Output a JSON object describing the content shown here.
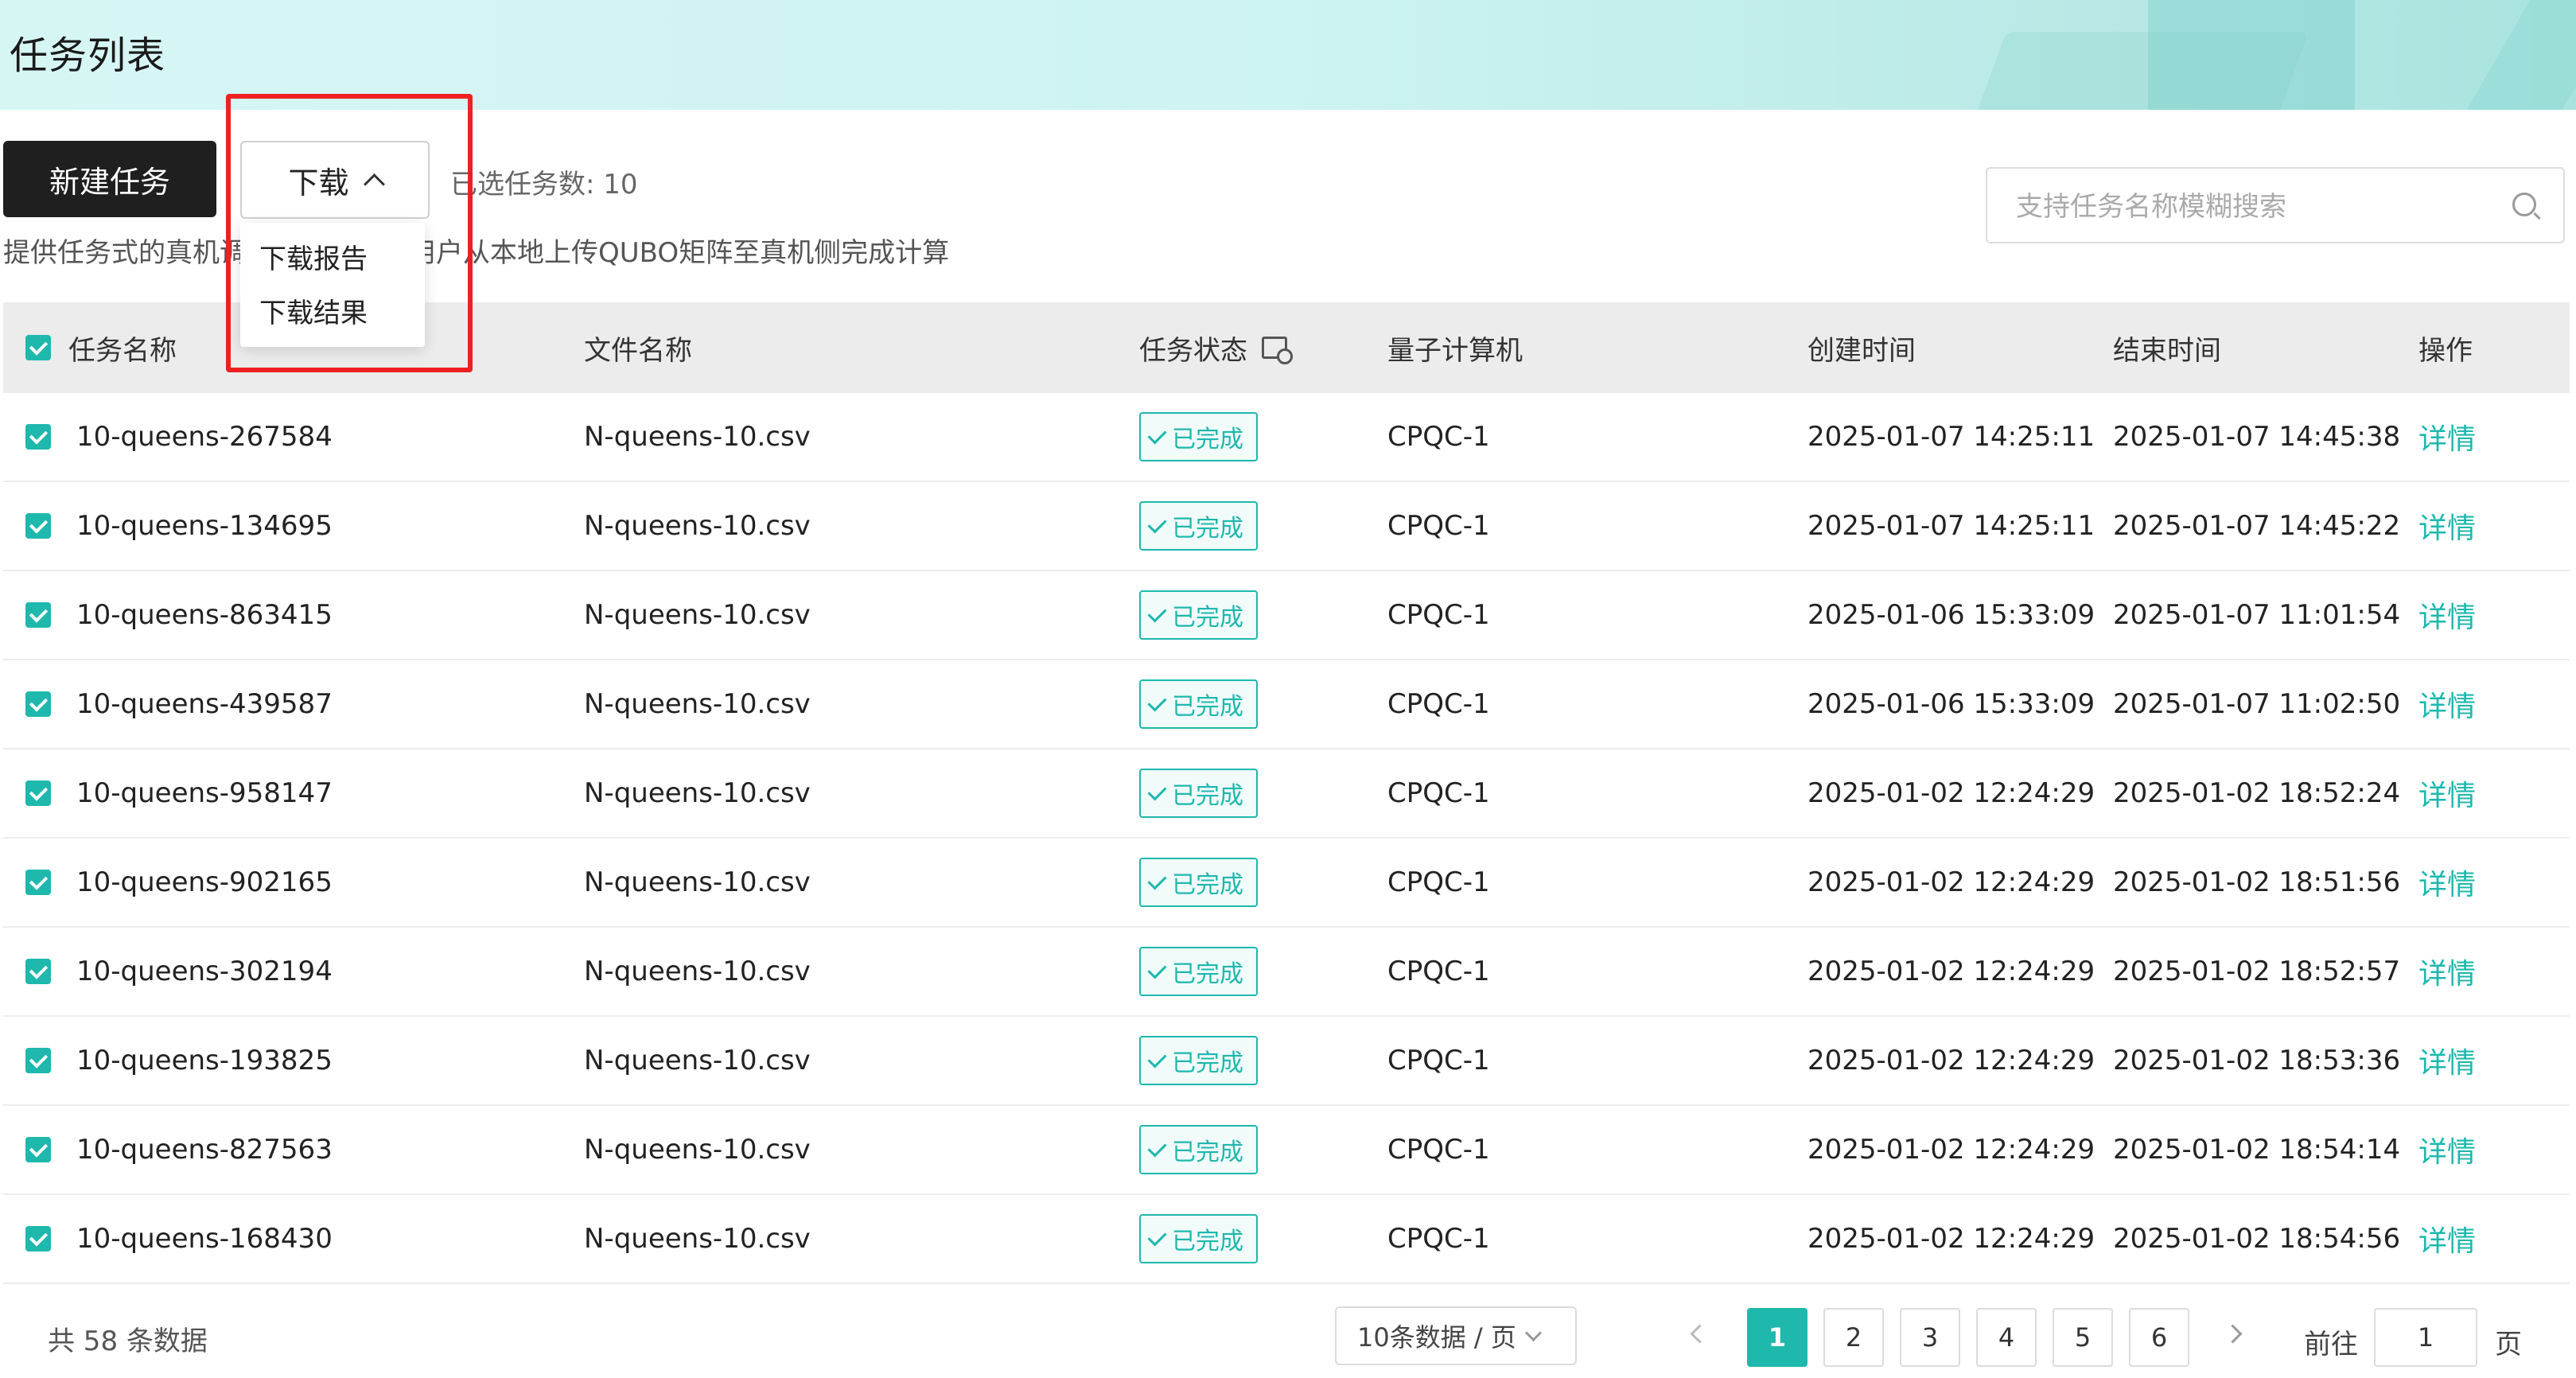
{
  "header": {
    "title": "任务列表"
  },
  "toolbar": {
    "new_task": "新建任务",
    "download": "下载",
    "selected_count": "已选任务数: 10",
    "description": "提供任务式的真机调用服务，支持用户从本地上传QUBO矩阵至真机侧完成计算"
  },
  "download_menu": {
    "items": [
      "下载报告",
      "下载结果"
    ]
  },
  "search": {
    "placeholder": "支持任务名称模糊搜索",
    "value": ""
  },
  "table": {
    "columns": [
      "任务名称",
      "文件名称",
      "任务状态",
      "量子计算机",
      "创建时间",
      "结束时间",
      "操作"
    ],
    "rows": [
      {
        "name": "10-queens-267584",
        "file": "N-queens-10.csv",
        "status": "已完成",
        "qc": "CPQC-1",
        "created": "2025-01-07 14:25:11",
        "ended": "2025-01-07 14:45:38",
        "action": "详情"
      },
      {
        "name": "10-queens-134695",
        "file": "N-queens-10.csv",
        "status": "已完成",
        "qc": "CPQC-1",
        "created": "2025-01-07 14:25:11",
        "ended": "2025-01-07 14:45:22",
        "action": "详情"
      },
      {
        "name": "10-queens-863415",
        "file": "N-queens-10.csv",
        "status": "已完成",
        "qc": "CPQC-1",
        "created": "2025-01-06 15:33:09",
        "ended": "2025-01-07 11:01:54",
        "action": "详情"
      },
      {
        "name": "10-queens-439587",
        "file": "N-queens-10.csv",
        "status": "已完成",
        "qc": "CPQC-1",
        "created": "2025-01-06 15:33:09",
        "ended": "2025-01-07 11:02:50",
        "action": "详情"
      },
      {
        "name": "10-queens-958147",
        "file": "N-queens-10.csv",
        "status": "已完成",
        "qc": "CPQC-1",
        "created": "2025-01-02 12:24:29",
        "ended": "2025-01-02 18:52:24",
        "action": "详情"
      },
      {
        "name": "10-queens-902165",
        "file": "N-queens-10.csv",
        "status": "已完成",
        "qc": "CPQC-1",
        "created": "2025-01-02 12:24:29",
        "ended": "2025-01-02 18:51:56",
        "action": "详情"
      },
      {
        "name": "10-queens-302194",
        "file": "N-queens-10.csv",
        "status": "已完成",
        "qc": "CPQC-1",
        "created": "2025-01-02 12:24:29",
        "ended": "2025-01-02 18:52:57",
        "action": "详情"
      },
      {
        "name": "10-queens-193825",
        "file": "N-queens-10.csv",
        "status": "已完成",
        "qc": "CPQC-1",
        "created": "2025-01-02 12:24:29",
        "ended": "2025-01-02 18:53:36",
        "action": "详情"
      },
      {
        "name": "10-queens-827563",
        "file": "N-queens-10.csv",
        "status": "已完成",
        "qc": "CPQC-1",
        "created": "2025-01-02 12:24:29",
        "ended": "2025-01-02 18:54:14",
        "action": "详情"
      },
      {
        "name": "10-queens-168430",
        "file": "N-queens-10.csv",
        "status": "已完成",
        "qc": "CPQC-1",
        "created": "2025-01-02 12:24:29",
        "ended": "2025-01-02 18:54:56",
        "action": "详情"
      }
    ]
  },
  "footer": {
    "total": "共 58 条数据",
    "page_size": "10条数据 / 页",
    "pages": [
      "1",
      "2",
      "3",
      "4",
      "5",
      "6"
    ],
    "current_page": "1",
    "goto_label": "前往",
    "goto_value": "1",
    "goto_suffix": "页"
  },
  "colors": {
    "accent": "#1eb8ad",
    "primary_button": "#1f1f1f",
    "highlight_box": "#ee2020"
  }
}
